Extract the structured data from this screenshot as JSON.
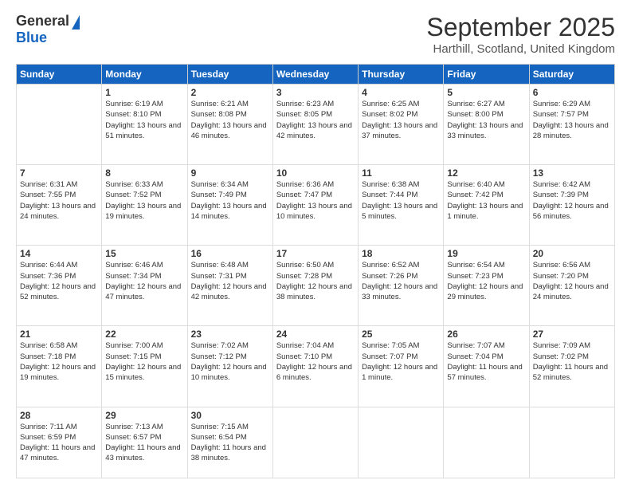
{
  "logo": {
    "general": "General",
    "blue": "Blue"
  },
  "title": "September 2025",
  "location": "Harthill, Scotland, United Kingdom",
  "header_days": [
    "Sunday",
    "Monday",
    "Tuesday",
    "Wednesday",
    "Thursday",
    "Friday",
    "Saturday"
  ],
  "weeks": [
    [
      {
        "day": "",
        "sunrise": "",
        "sunset": "",
        "daylight": ""
      },
      {
        "day": "1",
        "sunrise": "Sunrise: 6:19 AM",
        "sunset": "Sunset: 8:10 PM",
        "daylight": "Daylight: 13 hours and 51 minutes."
      },
      {
        "day": "2",
        "sunrise": "Sunrise: 6:21 AM",
        "sunset": "Sunset: 8:08 PM",
        "daylight": "Daylight: 13 hours and 46 minutes."
      },
      {
        "day": "3",
        "sunrise": "Sunrise: 6:23 AM",
        "sunset": "Sunset: 8:05 PM",
        "daylight": "Daylight: 13 hours and 42 minutes."
      },
      {
        "day": "4",
        "sunrise": "Sunrise: 6:25 AM",
        "sunset": "Sunset: 8:02 PM",
        "daylight": "Daylight: 13 hours and 37 minutes."
      },
      {
        "day": "5",
        "sunrise": "Sunrise: 6:27 AM",
        "sunset": "Sunset: 8:00 PM",
        "daylight": "Daylight: 13 hours and 33 minutes."
      },
      {
        "day": "6",
        "sunrise": "Sunrise: 6:29 AM",
        "sunset": "Sunset: 7:57 PM",
        "daylight": "Daylight: 13 hours and 28 minutes."
      }
    ],
    [
      {
        "day": "7",
        "sunrise": "Sunrise: 6:31 AM",
        "sunset": "Sunset: 7:55 PM",
        "daylight": "Daylight: 13 hours and 24 minutes."
      },
      {
        "day": "8",
        "sunrise": "Sunrise: 6:33 AM",
        "sunset": "Sunset: 7:52 PM",
        "daylight": "Daylight: 13 hours and 19 minutes."
      },
      {
        "day": "9",
        "sunrise": "Sunrise: 6:34 AM",
        "sunset": "Sunset: 7:49 PM",
        "daylight": "Daylight: 13 hours and 14 minutes."
      },
      {
        "day": "10",
        "sunrise": "Sunrise: 6:36 AM",
        "sunset": "Sunset: 7:47 PM",
        "daylight": "Daylight: 13 hours and 10 minutes."
      },
      {
        "day": "11",
        "sunrise": "Sunrise: 6:38 AM",
        "sunset": "Sunset: 7:44 PM",
        "daylight": "Daylight: 13 hours and 5 minutes."
      },
      {
        "day": "12",
        "sunrise": "Sunrise: 6:40 AM",
        "sunset": "Sunset: 7:42 PM",
        "daylight": "Daylight: 13 hours and 1 minute."
      },
      {
        "day": "13",
        "sunrise": "Sunrise: 6:42 AM",
        "sunset": "Sunset: 7:39 PM",
        "daylight": "Daylight: 12 hours and 56 minutes."
      }
    ],
    [
      {
        "day": "14",
        "sunrise": "Sunrise: 6:44 AM",
        "sunset": "Sunset: 7:36 PM",
        "daylight": "Daylight: 12 hours and 52 minutes."
      },
      {
        "day": "15",
        "sunrise": "Sunrise: 6:46 AM",
        "sunset": "Sunset: 7:34 PM",
        "daylight": "Daylight: 12 hours and 47 minutes."
      },
      {
        "day": "16",
        "sunrise": "Sunrise: 6:48 AM",
        "sunset": "Sunset: 7:31 PM",
        "daylight": "Daylight: 12 hours and 42 minutes."
      },
      {
        "day": "17",
        "sunrise": "Sunrise: 6:50 AM",
        "sunset": "Sunset: 7:28 PM",
        "daylight": "Daylight: 12 hours and 38 minutes."
      },
      {
        "day": "18",
        "sunrise": "Sunrise: 6:52 AM",
        "sunset": "Sunset: 7:26 PM",
        "daylight": "Daylight: 12 hours and 33 minutes."
      },
      {
        "day": "19",
        "sunrise": "Sunrise: 6:54 AM",
        "sunset": "Sunset: 7:23 PM",
        "daylight": "Daylight: 12 hours and 29 minutes."
      },
      {
        "day": "20",
        "sunrise": "Sunrise: 6:56 AM",
        "sunset": "Sunset: 7:20 PM",
        "daylight": "Daylight: 12 hours and 24 minutes."
      }
    ],
    [
      {
        "day": "21",
        "sunrise": "Sunrise: 6:58 AM",
        "sunset": "Sunset: 7:18 PM",
        "daylight": "Daylight: 12 hours and 19 minutes."
      },
      {
        "day": "22",
        "sunrise": "Sunrise: 7:00 AM",
        "sunset": "Sunset: 7:15 PM",
        "daylight": "Daylight: 12 hours and 15 minutes."
      },
      {
        "day": "23",
        "sunrise": "Sunrise: 7:02 AM",
        "sunset": "Sunset: 7:12 PM",
        "daylight": "Daylight: 12 hours and 10 minutes."
      },
      {
        "day": "24",
        "sunrise": "Sunrise: 7:04 AM",
        "sunset": "Sunset: 7:10 PM",
        "daylight": "Daylight: 12 hours and 6 minutes."
      },
      {
        "day": "25",
        "sunrise": "Sunrise: 7:05 AM",
        "sunset": "Sunset: 7:07 PM",
        "daylight": "Daylight: 12 hours and 1 minute."
      },
      {
        "day": "26",
        "sunrise": "Sunrise: 7:07 AM",
        "sunset": "Sunset: 7:04 PM",
        "daylight": "Daylight: 11 hours and 57 minutes."
      },
      {
        "day": "27",
        "sunrise": "Sunrise: 7:09 AM",
        "sunset": "Sunset: 7:02 PM",
        "daylight": "Daylight: 11 hours and 52 minutes."
      }
    ],
    [
      {
        "day": "28",
        "sunrise": "Sunrise: 7:11 AM",
        "sunset": "Sunset: 6:59 PM",
        "daylight": "Daylight: 11 hours and 47 minutes."
      },
      {
        "day": "29",
        "sunrise": "Sunrise: 7:13 AM",
        "sunset": "Sunset: 6:57 PM",
        "daylight": "Daylight: 11 hours and 43 minutes."
      },
      {
        "day": "30",
        "sunrise": "Sunrise: 7:15 AM",
        "sunset": "Sunset: 6:54 PM",
        "daylight": "Daylight: 11 hours and 38 minutes."
      },
      {
        "day": "",
        "sunrise": "",
        "sunset": "",
        "daylight": ""
      },
      {
        "day": "",
        "sunrise": "",
        "sunset": "",
        "daylight": ""
      },
      {
        "day": "",
        "sunrise": "",
        "sunset": "",
        "daylight": ""
      },
      {
        "day": "",
        "sunrise": "",
        "sunset": "",
        "daylight": ""
      }
    ]
  ]
}
